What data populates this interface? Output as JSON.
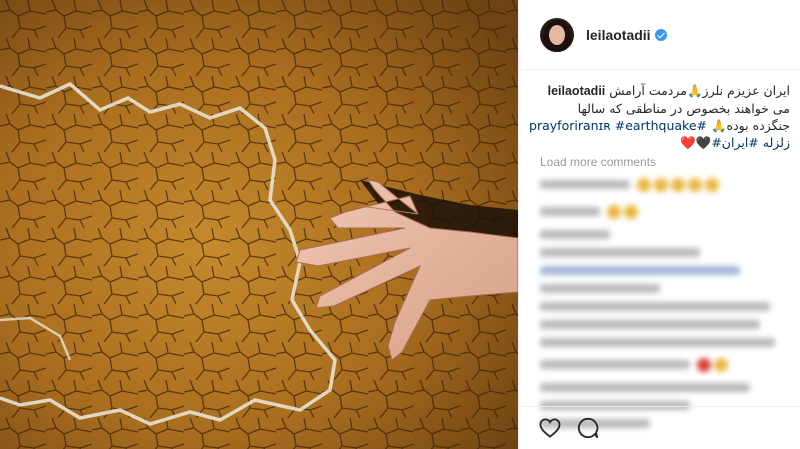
{
  "post": {
    "username": "leilaotadii",
    "caption": {
      "username": "leilaotadii",
      "line1": "ایران عزیزم نلرز🙏مردمت آرامش",
      "line2": "می خواهند بخصوص در مناطقی که سالها",
      "line3_text": "جنگزده بوده🙏",
      "line3_tags": "#prayforiranɪʀ #earthquake",
      "line4": "زلزله #ایران#🖤❤️"
    },
    "load_more_label": "Load more comments"
  },
  "colors": {
    "link": "#003569",
    "meta": "#999999",
    "verified": "#3897f0",
    "border": "#efefef"
  },
  "icons": {
    "verified": "verified-badge-icon",
    "like": "heart-icon",
    "comment": "comment-icon"
  }
}
